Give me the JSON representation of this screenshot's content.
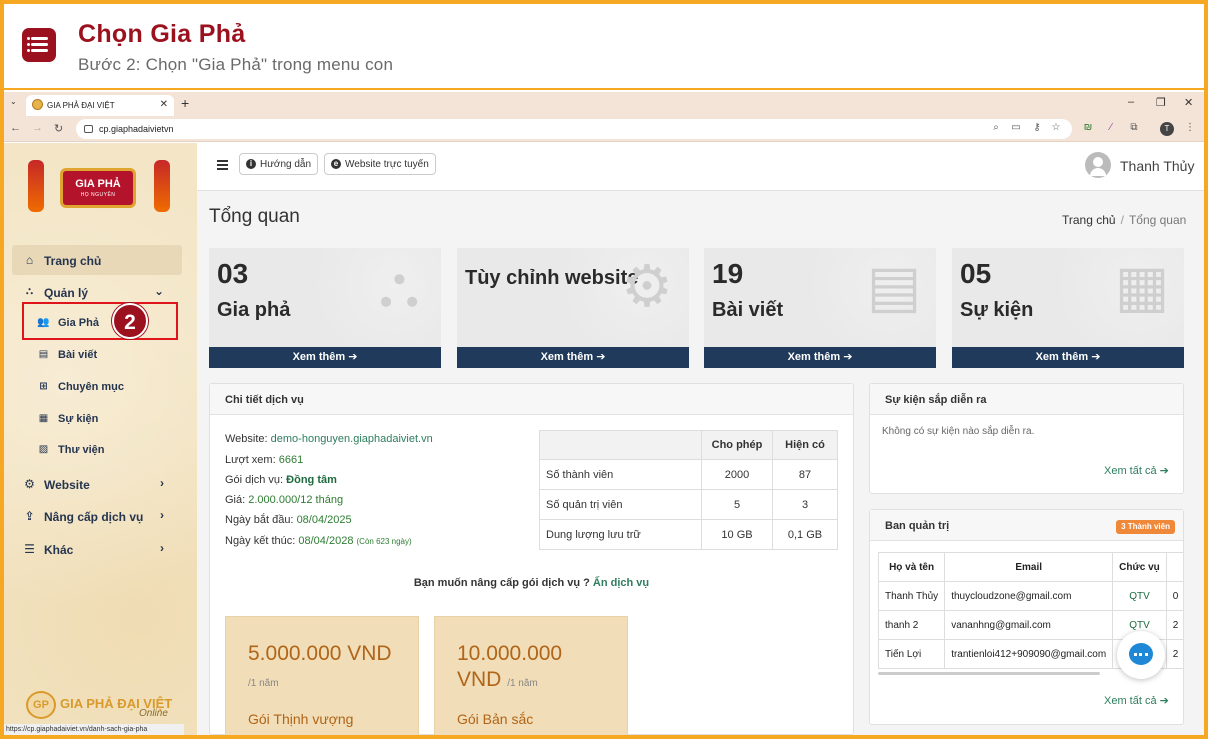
{
  "guide": {
    "title": "Chọn Gia Phả",
    "subtitle": "Bước 2: Chọn \"Gia Phả\" trong menu con",
    "step_number": "2"
  },
  "browser": {
    "tab_title": "GIA PHẢ ĐẠI VIỆT",
    "url": "cp.giaphadaivietvn",
    "status_url": "https://cp.giaphadaiviet.vn/danh-sach-gia-pha",
    "profile_initial": "T"
  },
  "sidebar": {
    "logo_text": "GIA PHẢ",
    "logo_subtext": "HỌ NGUYỄN",
    "items": [
      {
        "label": "Trang chủ",
        "icon": "home-icon"
      },
      {
        "label": "Quản lý",
        "icon": "sitemap-icon"
      },
      {
        "label": "Website",
        "icon": "gear-icon"
      },
      {
        "label": "Nâng cấp dịch vụ",
        "icon": "upgrade-icon"
      },
      {
        "label": "Khác",
        "icon": "grid-icon"
      }
    ],
    "subitems": [
      {
        "label": "Gia Phả",
        "icon": "users-icon"
      },
      {
        "label": "Bài viết",
        "icon": "newspaper-icon"
      },
      {
        "label": "Chuyên mục",
        "icon": "table-icon"
      },
      {
        "label": "Sự kiện",
        "icon": "calendar-icon"
      },
      {
        "label": "Thư viện",
        "icon": "images-icon"
      }
    ],
    "footer_logo": "GIA PHẢ ĐẠI VIỆT",
    "footer_logo_mark": "GP",
    "footer_logo_online": "Online"
  },
  "header": {
    "guide_button": "Hướng dẫn",
    "website_button": "Website trực tuyến",
    "user_name": "Thanh Thủy"
  },
  "page": {
    "title": "Tổng quan",
    "breadcrumb_home": "Trang chủ",
    "breadcrumb_sep": "/",
    "breadcrumb_current": "Tổng quan"
  },
  "cards": [
    {
      "number": "03",
      "label": "Gia phả",
      "more": "Xem thêm",
      "icon": "sitemap-icon"
    },
    {
      "number": "",
      "label": "Tùy chỉnh website",
      "more": "Xem thêm",
      "icon": "gears-icon"
    },
    {
      "number": "19",
      "label": "Bài viết",
      "more": "Xem thêm",
      "icon": "newspaper-icon"
    },
    {
      "number": "05",
      "label": "Sự kiện",
      "more": "Xem thêm",
      "icon": "calendar-icon"
    }
  ],
  "service": {
    "title": "Chi tiết dịch vụ",
    "website_label": "Website:",
    "website_value": "demo-honguyen.giaphadaiviet.vn",
    "views_label": "Lượt xem:",
    "views_value": "6661",
    "package_label": "Gói dịch vụ:",
    "package_value": "Đồng tâm",
    "price_label": "Giá:",
    "price_value": "2.000.000/12 tháng",
    "start_label": "Ngày bắt đầu:",
    "start_value": "08/04/2025",
    "end_label": "Ngày kết thúc:",
    "end_value": "08/04/2028",
    "remaining": "(Còn 623 ngày)",
    "table_headers": [
      "",
      "Cho phép",
      "Hiện có"
    ],
    "table_rows": [
      [
        "Số thành viên",
        "2000",
        "87"
      ],
      [
        "Số quản trị viên",
        "5",
        "3"
      ],
      [
        "Dung lượng lưu trữ",
        "10 GB",
        "0,1 GB"
      ]
    ],
    "upgrade_text": "Bạn muốn nâng cấp gói dịch vụ ?",
    "upgrade_link": "Ấn dịch vụ",
    "plans": [
      {
        "price": "5.000.000 VND",
        "period": "/1 năm",
        "name": "Gói Thịnh vượng"
      },
      {
        "price_line1": "10.000.000",
        "price_line2": "VND",
        "period": "/1 năm",
        "name": "Gói Bản sắc"
      }
    ]
  },
  "events": {
    "title": "Sự kiện sắp diễn ra",
    "empty": "Không có sự kiện nào sắp diễn ra.",
    "see_all": "Xem tất cả"
  },
  "admins": {
    "title": "Ban quản trị",
    "badge": "3 Thành viên",
    "headers": [
      "Họ và tên",
      "Email",
      "Chức vụ"
    ],
    "rows": [
      {
        "name": "Thanh Thủy",
        "email": "thuycloudzone@gmail.com",
        "role": "QTV",
        "extra": "0"
      },
      {
        "name": "thanh 2",
        "email": "vananhng@gmail.com",
        "role": "QTV",
        "extra": "2"
      },
      {
        "name": "Tiến Lợi",
        "email": "trantienloi412+909090@gmail.com",
        "role": "",
        "extra": "2"
      }
    ],
    "see_all": "Xem tất cả"
  },
  "colors": {
    "accent": "#9b111e",
    "frame": "#f6a823",
    "card_footer": "#1f3a5a",
    "highlight_box": "#e0151c"
  }
}
